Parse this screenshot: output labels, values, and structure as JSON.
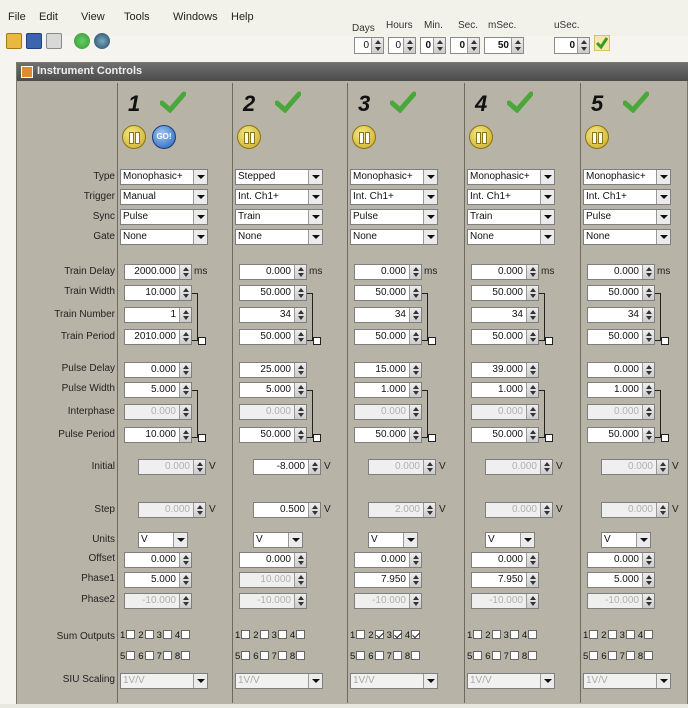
{
  "menu": [
    "File",
    "Edit",
    "View",
    "Tools",
    "Windows",
    "Help"
  ],
  "time_controls": [
    {
      "label": "Days",
      "value": "0"
    },
    {
      "label": "Hours",
      "value": "0"
    },
    {
      "label": "Min.",
      "value": "0"
    },
    {
      "label": "Sec.",
      "value": "0"
    },
    {
      "label": "mSec.",
      "value": "50"
    },
    {
      "label": "uSec.",
      "value": "0"
    }
  ],
  "window_title": "Instrument Controls",
  "row_labels": {
    "type": "Type",
    "trigger": "Trigger",
    "sync": "Sync",
    "gate": "Gate",
    "train_delay": "Train Delay",
    "train_width": "Train Width",
    "train_number": "Train Number",
    "train_period": "Train Period",
    "pulse_delay": "Pulse Delay",
    "pulse_width": "Pulse Width",
    "interphase": "Interphase",
    "pulse_period": "Pulse Period",
    "initial": "Initial",
    "step": "Step",
    "units": "Units",
    "offset": "Offset",
    "phase1": "Phase1",
    "phase2": "Phase2",
    "sum_outputs": "Sum Outputs",
    "siu_scaling": "SIU Scaling"
  },
  "unit_ms": "ms",
  "unit_v": "V",
  "go_label": "GO!",
  "channels": [
    {
      "num": "1",
      "type": "Monophasic+",
      "trigger": "Manual",
      "sync": "Pulse",
      "gate": "None",
      "train_delay": "2000.000",
      "train_width": "10.000",
      "train_number": "1",
      "train_period": "2010.000",
      "pulse_delay": "0.000",
      "pulse_width": "5.000",
      "interphase": "0.000",
      "pulse_period": "10.000",
      "initial": "0.000",
      "step": "0.000",
      "units": "V",
      "offset": "0.000",
      "phase1": "5.000",
      "phase2": "-10.000",
      "sum": [
        false,
        false,
        false,
        false,
        false,
        false,
        false,
        false
      ],
      "siu": "1V/V",
      "go": true,
      "initial_enabled": false,
      "step_enabled": false,
      "phase1_enabled": true
    },
    {
      "num": "2",
      "type": "Stepped",
      "trigger": "Int. Ch1+",
      "sync": "Train",
      "gate": "None",
      "train_delay": "0.000",
      "train_width": "50.000",
      "train_number": "34",
      "train_period": "50.000",
      "pulse_delay": "25.000",
      "pulse_width": "5.000",
      "interphase": "0.000",
      "pulse_period": "50.000",
      "initial": "-8.000",
      "step": "0.500",
      "units": "V",
      "offset": "0.000",
      "phase1": "10.000",
      "phase2": "-10.000",
      "sum": [
        false,
        false,
        false,
        false,
        false,
        false,
        false,
        false
      ],
      "siu": "1V/V",
      "go": false,
      "initial_enabled": true,
      "step_enabled": true,
      "phase1_enabled": false
    },
    {
      "num": "3",
      "type": "Monophasic+",
      "trigger": "Int. Ch1+",
      "sync": "Pulse",
      "gate": "None",
      "train_delay": "0.000",
      "train_width": "50.000",
      "train_number": "34",
      "train_period": "50.000",
      "pulse_delay": "15.000",
      "pulse_width": "1.000",
      "interphase": "0.000",
      "pulse_period": "50.000",
      "initial": "0.000",
      "step": "2.000",
      "units": "V",
      "offset": "0.000",
      "phase1": "7.950",
      "phase2": "-10.000",
      "sum": [
        false,
        true,
        true,
        true,
        false,
        false,
        false,
        false
      ],
      "siu": "1V/V",
      "go": false,
      "initial_enabled": false,
      "step_enabled": false,
      "phase1_enabled": true
    },
    {
      "num": "4",
      "type": "Monophasic+",
      "trigger": "Int. Ch1+",
      "sync": "Train",
      "gate": "None",
      "train_delay": "0.000",
      "train_width": "50.000",
      "train_number": "34",
      "train_period": "50.000",
      "pulse_delay": "39.000",
      "pulse_width": "1.000",
      "interphase": "0.000",
      "pulse_period": "50.000",
      "initial": "0.000",
      "step": "0.000",
      "units": "V",
      "offset": "0.000",
      "phase1": "7.950",
      "phase2": "-10.000",
      "sum": [
        false,
        false,
        false,
        false,
        false,
        false,
        false,
        false
      ],
      "siu": "1V/V",
      "go": false,
      "initial_enabled": false,
      "step_enabled": false,
      "phase1_enabled": true
    },
    {
      "num": "5",
      "type": "Monophasic+",
      "trigger": "Int. Ch1+",
      "sync": "Pulse",
      "gate": "None",
      "train_delay": "0.000",
      "train_width": "50.000",
      "train_number": "34",
      "train_period": "50.000",
      "pulse_delay": "0.000",
      "pulse_width": "1.000",
      "interphase": "0.000",
      "pulse_period": "50.000",
      "initial": "0.000",
      "step": "0.000",
      "units": "V",
      "offset": "0.000",
      "phase1": "5.000",
      "phase2": "-10.000",
      "sum": [
        false,
        false,
        false,
        false,
        false,
        false,
        false,
        false
      ],
      "siu": "1V/V",
      "go": false,
      "initial_enabled": false,
      "step_enabled": false,
      "phase1_enabled": true
    }
  ]
}
